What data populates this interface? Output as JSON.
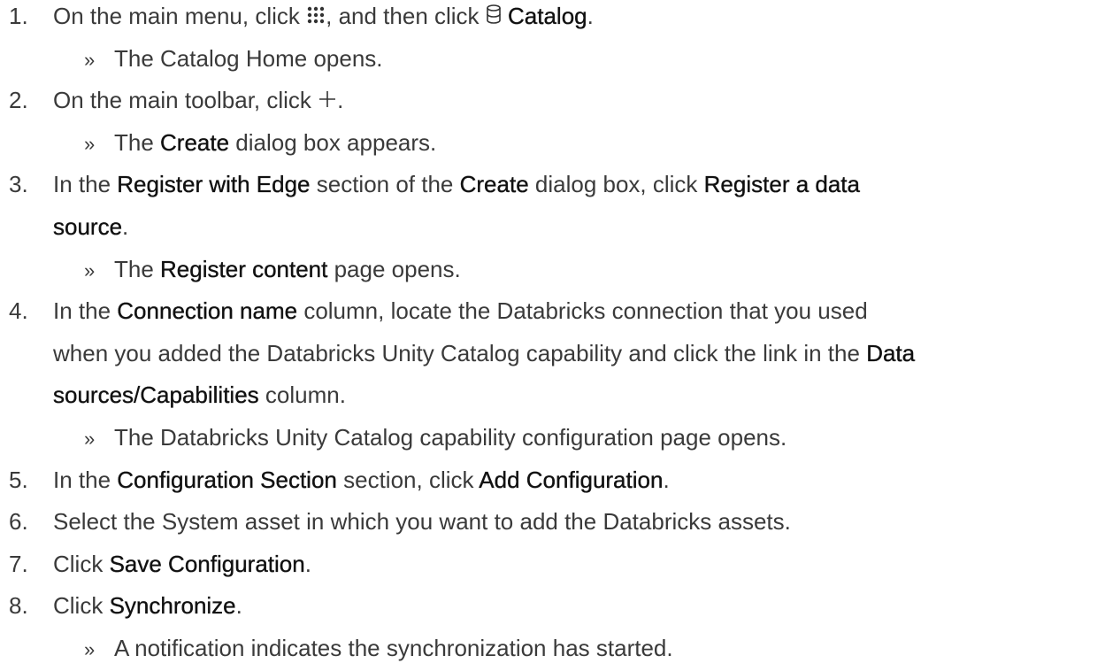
{
  "steps": [
    {
      "num": "1.",
      "parts": [
        "On the main menu, click ",
        "",
        ", and then click ",
        "",
        " ",
        "Catalog",
        "."
      ],
      "icons": [
        "apps-grid-icon",
        "database-icon"
      ],
      "result": "The Catalog Home opens."
    },
    {
      "num": "2.",
      "parts": [
        "On the main toolbar, click ",
        "",
        "."
      ],
      "icons": [
        "plus-icon"
      ],
      "result_pre": "The ",
      "result_bold": "Create",
      "result_post": " dialog box appears."
    },
    {
      "num": "3.",
      "line1_a": "In the ",
      "line1_b": "Register with Edge",
      "line1_c": " section of the ",
      "line1_d": "Create",
      "line1_e": " dialog box, click ",
      "line1_f": "Register a data",
      "line2_a": "source",
      "line2_b": ".",
      "result_pre": "The ",
      "result_bold": "Register content",
      "result_post": " page opens."
    },
    {
      "num": "4.",
      "line1_a": " In the ",
      "line1_b": "Connection name",
      "line1_c": " column, locate the Databricks connection that you used",
      "line2_a": "when you added the Databricks Unity Catalog capability and click the link in the ",
      "line2_b": "Data",
      "line3_a": "sources/Capabilities",
      "line3_b": " column.",
      "result": "The Databricks Unity Catalog capability configuration page opens."
    },
    {
      "num": "5.",
      "a": "In the ",
      "b": "Configuration Section",
      "c": " section, click ",
      "d": "Add Configuration",
      "e": "."
    },
    {
      "num": "6.",
      "a": "Select the System asset in which you want to add the Databricks assets."
    },
    {
      "num": "7.",
      "a": "Click ",
      "b": "Save Configuration",
      "c": "."
    },
    {
      "num": "8.",
      "a": "Click ",
      "b": "Synchronize",
      "c": ".",
      "result": "A notification indicates the synchronization has started."
    }
  ],
  "result_marker": "»"
}
